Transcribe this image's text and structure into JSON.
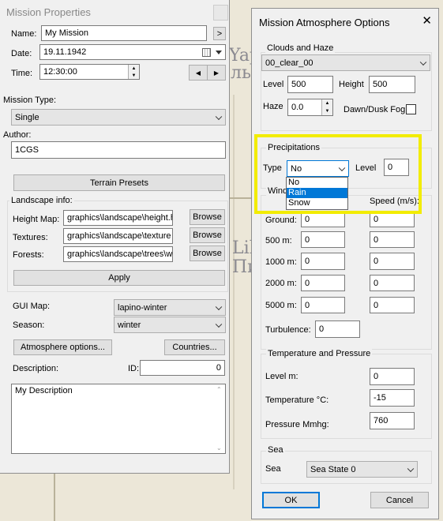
{
  "map": {
    "labels": [
      "Yapitan",
      "ль",
      "Lih",
      "Пиф"
    ]
  },
  "mission": {
    "title": "Mission Properties",
    "name_label": "Name:",
    "name_value": "My Mission",
    "name_btn": ">",
    "date_label": "Date:",
    "date_value": "19.11.1942",
    "time_label": "Time:",
    "time_value": "12:30:00",
    "prev_btn": "◀",
    "next_btn": "▶",
    "type_label": "Mission Type:",
    "type_value": "Single",
    "author_label": "Author:",
    "author_value": "1CGS",
    "terrain_btn": "Terrain Presets",
    "landscape_label": "Landscape info:",
    "heightmap_label": "Height Map:",
    "heightmap_value": "graphics\\landscape\\height.h",
    "textures_label": "Textures:",
    "textures_value": "graphics\\landscape\\texture",
    "forests_label": "Forests:",
    "forests_value": "graphics\\landscape\\trees\\w",
    "browse": "Browse",
    "apply_btn": "Apply",
    "guimap_label": "GUI Map:",
    "guimap_value": "lapino-winter",
    "season_label": "Season:",
    "season_value": "winter",
    "atmo_btn": "Atmosphere options...",
    "countries_btn": "Countries...",
    "desc_label": "Description:",
    "id_label": "ID:",
    "id_value": "0",
    "desc_value": "My Description"
  },
  "atmo": {
    "title": "Mission Atmosphere Options",
    "close": "✕",
    "clouds_group": "Clouds and Haze",
    "clouds_value": "00_clear_00",
    "level_label": "Level",
    "level_value": "500",
    "height_label": "Height",
    "height_value": "500",
    "haze_label": "Haze",
    "haze_value": "0.0",
    "dawn_label": "Dawn/Dusk Fog",
    "precip_group": "Precipitations",
    "type_label": "Type",
    "type_value": "No",
    "precip_level_label": "Level",
    "precip_level_value": "0",
    "dropdown_options": [
      "No",
      "Rain",
      "Snow"
    ],
    "wind_group": "Wind",
    "speed_label": "Speed (m/s):",
    "wind_rows": [
      {
        "label": "Ground:",
        "dir": "0",
        "speed": "0"
      },
      {
        "label": "500 m:",
        "dir": "0",
        "speed": "0"
      },
      {
        "label": "1000 m:",
        "dir": "0",
        "speed": "0"
      },
      {
        "label": "2000 m:",
        "dir": "0",
        "speed": "0"
      },
      {
        "label": "5000 m:",
        "dir": "0",
        "speed": "0"
      }
    ],
    "turbulence_label": "Turbulence:",
    "turbulence_value": "0",
    "temp_group": "Temperature and Pressure",
    "levelm_label": "Level m:",
    "levelm_value": "0",
    "temperature_label": "Temperature °C:",
    "temperature_value": "-15",
    "pressure_label": "Pressure Mmhg:",
    "pressure_value": "760",
    "sea_group": "Sea",
    "sea_label": "Sea",
    "sea_value": "Sea State 0",
    "ok_btn": "OK",
    "cancel_btn": "Cancel"
  },
  "colors": {
    "highlight": "#f2ec00",
    "selection": "#0078d7"
  }
}
